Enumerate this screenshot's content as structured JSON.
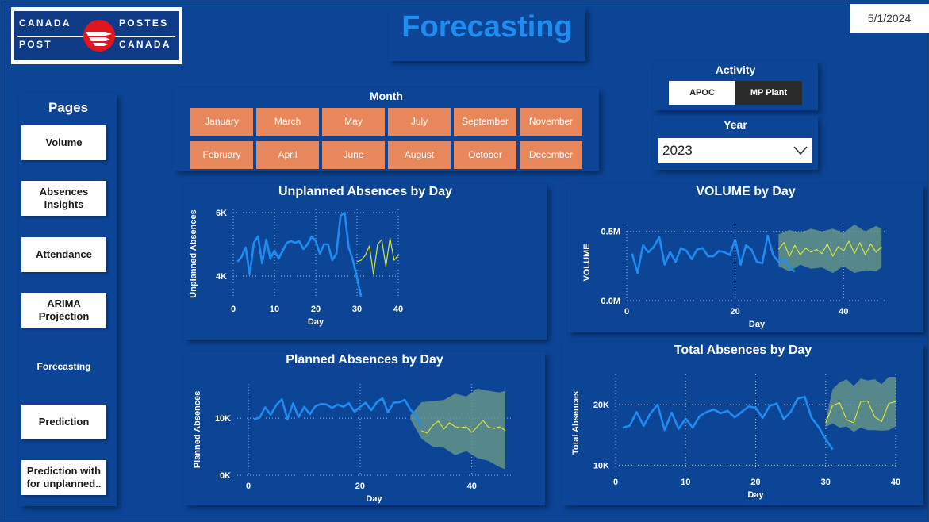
{
  "logo": {
    "w1": "CANADA",
    "w2": "POSTES",
    "w3": "POST",
    "w4": "CANADA"
  },
  "title": "Forecasting",
  "date": "5/1/2024",
  "pages": {
    "heading": "Pages",
    "items": [
      {
        "label": "Volume"
      },
      {
        "label": "Absences Insights"
      },
      {
        "label": "Attendance"
      },
      {
        "label": "ARIMA Projection"
      },
      {
        "label": "Forecasting"
      },
      {
        "label": "Prediction"
      },
      {
        "label": "Prediction with for unplanned.."
      }
    ]
  },
  "month_filter": {
    "label": "Month",
    "row1": [
      "January",
      "March",
      "May",
      "July",
      "September",
      "November"
    ],
    "row2": [
      "February",
      "April",
      "June",
      "August",
      "October",
      "December"
    ]
  },
  "activity": {
    "label": "Activity",
    "options": [
      "APOC",
      "MP Plant"
    ],
    "selected": "MP Plant"
  },
  "year": {
    "label": "Year",
    "value": "2023"
  },
  "colors": {
    "actual": "#1e8cf0",
    "forecast": "#d9e23a",
    "band": "#6b9a86",
    "slicer": "#e8875c"
  },
  "chart_data": [
    {
      "type": "line",
      "title": "Unplanned Absences by Day",
      "xlabel": "Day",
      "ylabel": "Unplanned Absences",
      "xlim": [
        0,
        40
      ],
      "ylim": [
        3300,
        6100
      ],
      "yticks": [
        4000,
        6000
      ],
      "ytick_labels": [
        "4K",
        "6K"
      ],
      "xticks": [
        0,
        10,
        20,
        30,
        40
      ],
      "series": [
        {
          "role": "actual",
          "x": [
            1,
            2,
            3,
            4,
            5,
            6,
            7,
            8,
            9,
            10,
            11,
            12,
            13,
            14,
            15,
            16,
            17,
            18,
            19,
            20,
            21,
            22,
            23,
            24,
            25,
            26,
            27,
            28,
            29,
            30,
            31
          ],
          "values": [
            4450,
            4600,
            4900,
            4050,
            5050,
            5250,
            4400,
            5150,
            4550,
            4800,
            4550,
            4800,
            5050,
            5100,
            5050,
            5100,
            4850,
            5000,
            5250,
            5100,
            4700,
            5000,
            5000,
            4500,
            4700,
            5900,
            6000,
            4900,
            4500,
            3950,
            3350
          ]
        },
        {
          "role": "forecast",
          "x": [
            30,
            31,
            32,
            33,
            34,
            35,
            36,
            37,
            38,
            39,
            40
          ],
          "values": [
            4450,
            4500,
            4650,
            4950,
            4050,
            5000,
            5150,
            4300,
            5200,
            4500,
            4650
          ]
        }
      ]
    },
    {
      "type": "line",
      "title": "VOLUME by Day",
      "xlabel": "Day",
      "ylabel": "VOLUME",
      "xlim": [
        0,
        48
      ],
      "ylim": [
        0,
        0.55
      ],
      "yticks": [
        0,
        0.5
      ],
      "ytick_labels": [
        "0.0M",
        "0.5M"
      ],
      "xticks": [
        0,
        20,
        40
      ],
      "series": [
        {
          "role": "actual",
          "x": [
            1,
            2,
            3,
            4,
            5,
            6,
            7,
            8,
            9,
            10,
            11,
            12,
            13,
            14,
            15,
            16,
            17,
            18,
            19,
            20,
            21,
            22,
            23,
            24,
            25,
            26,
            27,
            28,
            29,
            30,
            31
          ],
          "values": [
            0.34,
            0.2,
            0.4,
            0.35,
            0.39,
            0.46,
            0.26,
            0.35,
            0.28,
            0.38,
            0.36,
            0.3,
            0.37,
            0.38,
            0.32,
            0.32,
            0.36,
            0.35,
            0.33,
            0.44,
            0.26,
            0.4,
            0.37,
            0.28,
            0.27,
            0.47,
            0.33,
            0.28,
            0.3,
            0.24,
            0.21
          ]
        },
        {
          "role": "forecast",
          "x": [
            28,
            29,
            30,
            31,
            32,
            33,
            34,
            35,
            36,
            37,
            38,
            39,
            40,
            41,
            42,
            43,
            44,
            45,
            46,
            47
          ],
          "values": [
            0.37,
            0.42,
            0.32,
            0.4,
            0.33,
            0.38,
            0.35,
            0.37,
            0.34,
            0.41,
            0.32,
            0.39,
            0.36,
            0.43,
            0.34,
            0.42,
            0.33,
            0.41,
            0.35,
            0.39
          ]
        },
        {
          "role": "band",
          "x": [
            28,
            30,
            32,
            34,
            36,
            38,
            40,
            42,
            44,
            46,
            47
          ],
          "upper": [
            0.48,
            0.51,
            0.49,
            0.52,
            0.5,
            0.52,
            0.49,
            0.55,
            0.5,
            0.54,
            0.52
          ],
          "lower": [
            0.25,
            0.21,
            0.26,
            0.23,
            0.24,
            0.2,
            0.25,
            0.2,
            0.22,
            0.21,
            0.24
          ]
        }
      ]
    },
    {
      "type": "line",
      "title": "Planned Absences by Day",
      "xlabel": "Day",
      "ylabel": "Planned Absences",
      "xlim": [
        -2,
        47
      ],
      "ylim": [
        0,
        16000
      ],
      "yticks": [
        0,
        10000
      ],
      "ytick_labels": [
        "0K",
        "10K"
      ],
      "xticks": [
        0,
        20,
        40
      ],
      "series": [
        {
          "role": "actual",
          "x": [
            1,
            2,
            3,
            4,
            5,
            6,
            7,
            8,
            9,
            10,
            11,
            12,
            13,
            14,
            15,
            16,
            17,
            18,
            19,
            20,
            21,
            22,
            23,
            24,
            25,
            26,
            27,
            28,
            29,
            30,
            31
          ],
          "values": [
            9800,
            10100,
            11900,
            10600,
            12300,
            13300,
            9800,
            12600,
            10200,
            12000,
            10700,
            12100,
            12500,
            12400,
            11800,
            12400,
            12000,
            12600,
            11100,
            12000,
            12700,
            11400,
            12800,
            13500,
            11000,
            12700,
            12800,
            13200,
            11500,
            10500,
            8700
          ]
        },
        {
          "role": "forecast",
          "x": [
            31,
            32,
            33,
            34,
            35,
            36,
            37,
            38,
            39,
            40,
            41,
            42,
            43,
            44,
            45,
            46
          ],
          "values": [
            7800,
            7400,
            8700,
            9500,
            8100,
            9200,
            8500,
            8300,
            8500,
            7500,
            8500,
            9600,
            8400,
            8200,
            8500,
            7800
          ]
        },
        {
          "role": "band",
          "x": [
            29,
            31,
            33,
            35,
            37,
            39,
            41,
            43,
            45,
            46
          ],
          "upper": [
            10500,
            12800,
            13000,
            13200,
            14300,
            13800,
            15200,
            14800,
            14500,
            14800
          ],
          "lower": [
            9800,
            6400,
            5000,
            4800,
            3500,
            4200,
            3000,
            2500,
            1400,
            1000
          ]
        }
      ]
    },
    {
      "type": "line",
      "title": "Total Absences by Day",
      "xlabel": "Day",
      "ylabel": "Total Absences",
      "xlim": [
        0,
        40
      ],
      "ylim": [
        9000,
        25000
      ],
      "yticks": [
        10000,
        20000
      ],
      "ytick_labels": [
        "10K",
        "20K"
      ],
      "xticks": [
        0,
        10,
        20,
        30,
        40
      ],
      "series": [
        {
          "role": "actual",
          "x": [
            1,
            2,
            3,
            4,
            5,
            6,
            7,
            8,
            9,
            10,
            11,
            12,
            13,
            14,
            15,
            16,
            17,
            18,
            19,
            20,
            21,
            22,
            23,
            24,
            25,
            26,
            27,
            28,
            29,
            30,
            31
          ],
          "values": [
            16200,
            16500,
            18800,
            16500,
            18600,
            20000,
            15800,
            18700,
            16000,
            17700,
            16200,
            18100,
            18800,
            19200,
            18600,
            19000,
            17900,
            18800,
            19700,
            19500,
            17800,
            19800,
            20200,
            17600,
            18800,
            21000,
            21300,
            17800,
            16300,
            14300,
            12600
          ]
        },
        {
          "role": "forecast",
          "x": [
            30,
            31,
            32,
            33,
            34,
            35,
            36,
            37,
            38,
            39,
            40
          ],
          "values": [
            17000,
            19900,
            20300,
            17500,
            17000,
            20500,
            20600,
            18000,
            17200,
            20200,
            20500
          ]
        },
        {
          "role": "band",
          "x": [
            30,
            31,
            32,
            33,
            34,
            35,
            36,
            37,
            38,
            39,
            40
          ],
          "upper": [
            17500,
            22600,
            23700,
            24200,
            23100,
            24300,
            24000,
            24200,
            23400,
            24600,
            24600
          ],
          "lower": [
            16300,
            16900,
            16200,
            16400,
            15500,
            16200,
            15800,
            15800,
            15700,
            15800,
            16400
          ]
        }
      ]
    }
  ]
}
